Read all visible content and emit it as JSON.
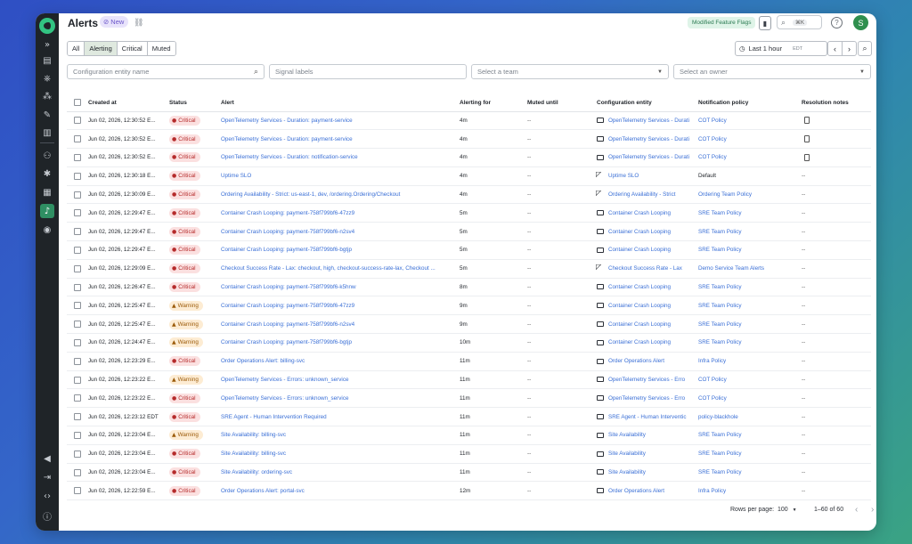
{
  "header": {
    "title": "Alerts",
    "new_badge": "New",
    "feature_flags": "Modified Feature Flags",
    "search_kbd": "⌘K",
    "avatar_initial": "S"
  },
  "tabs": [
    "All",
    "Alerting",
    "Critical",
    "Muted"
  ],
  "active_tab": "Alerting",
  "time_range": {
    "label": "Last 1 hour",
    "tz": "EDT"
  },
  "filters": {
    "entity_placeholder": "Configuration entity name",
    "signal_placeholder": "Signal labels",
    "team_placeholder": "Select a team",
    "owner_placeholder": "Select an owner"
  },
  "columns": [
    "Created at",
    "Status",
    "Alert",
    "Alerting for",
    "Muted until",
    "Configuration entity",
    "Notification policy",
    "Resolution notes"
  ],
  "rows": [
    {
      "created": "Jun 02, 2026, 12:30:52 E...",
      "status": "Critical",
      "alert": "OpenTelemetry Services - Duration: payment-service",
      "for": "4m",
      "muted": "--",
      "entity": "OpenTelemetry Services - Durati",
      "etype": "box",
      "policy": "COT Policy",
      "plink": true,
      "note": true
    },
    {
      "created": "Jun 02, 2026, 12:30:52 E...",
      "status": "Critical",
      "alert": "OpenTelemetry Services - Duration: payment-service",
      "for": "4m",
      "muted": "--",
      "entity": "OpenTelemetry Services - Durati",
      "etype": "box",
      "policy": "COT Policy",
      "plink": true,
      "note": true
    },
    {
      "created": "Jun 02, 2026, 12:30:52 E...",
      "status": "Critical",
      "alert": "OpenTelemetry Services - Duration: notification-service",
      "for": "4m",
      "muted": "--",
      "entity": "OpenTelemetry Services - Durati",
      "etype": "box",
      "policy": "COT Policy",
      "plink": true,
      "note": true
    },
    {
      "created": "Jun 02, 2026, 12:30:18 E...",
      "status": "Critical",
      "alert": "Uptime SLO",
      "for": "4m",
      "muted": "--",
      "entity": "Uptime SLO",
      "etype": "tri",
      "policy": "Default",
      "plink": false,
      "note": false
    },
    {
      "created": "Jun 02, 2026, 12:30:09 E...",
      "status": "Critical",
      "alert": "Ordering Availability - Strict: us-east-1, dev, /ordering.Ordering/Checkout",
      "for": "4m",
      "muted": "--",
      "entity": "Ordering Availability - Strict",
      "etype": "tri",
      "policy": "Ordering Team Policy",
      "plink": true,
      "note": false
    },
    {
      "created": "Jun 02, 2026, 12:29:47 E...",
      "status": "Critical",
      "alert": "Container Crash Looping: payment-758f799bf6-47zz9",
      "for": "5m",
      "muted": "--",
      "entity": "Container Crash Looping",
      "etype": "box",
      "policy": "SRE Team Policy",
      "plink": true,
      "note": false
    },
    {
      "created": "Jun 02, 2026, 12:29:47 E...",
      "status": "Critical",
      "alert": "Container Crash Looping: payment-758f799bf6-n2sv4",
      "for": "5m",
      "muted": "--",
      "entity": "Container Crash Looping",
      "etype": "box",
      "policy": "SRE Team Policy",
      "plink": true,
      "note": false
    },
    {
      "created": "Jun 02, 2026, 12:29:47 E...",
      "status": "Critical",
      "alert": "Container Crash Looping: payment-758f799bf6-bgtjp",
      "for": "5m",
      "muted": "--",
      "entity": "Container Crash Looping",
      "etype": "box",
      "policy": "SRE Team Policy",
      "plink": true,
      "note": false
    },
    {
      "created": "Jun 02, 2026, 12:29:09 E...",
      "status": "Critical",
      "alert": "Checkout Success Rate - Lax: checkout, high, checkout-success-rate-lax, Checkout ...",
      "for": "5m",
      "muted": "--",
      "entity": "Checkout Success Rate - Lax",
      "etype": "tri",
      "policy": "Demo Service Team Alerts",
      "plink": true,
      "note": false
    },
    {
      "created": "Jun 02, 2026, 12:26:47 E...",
      "status": "Critical",
      "alert": "Container Crash Looping: payment-758f799bf6-k5hnw",
      "for": "8m",
      "muted": "--",
      "entity": "Container Crash Looping",
      "etype": "box",
      "policy": "SRE Team Policy",
      "plink": true,
      "note": false
    },
    {
      "created": "Jun 02, 2026, 12:25:47 E...",
      "status": "Warning",
      "alert": "Container Crash Looping: payment-758f799bf6-47zz9",
      "for": "9m",
      "muted": "--",
      "entity": "Container Crash Looping",
      "etype": "box",
      "policy": "SRE Team Policy",
      "plink": true,
      "note": false
    },
    {
      "created": "Jun 02, 2026, 12:25:47 E...",
      "status": "Warning",
      "alert": "Container Crash Looping: payment-758f799bf6-n2sv4",
      "for": "9m",
      "muted": "--",
      "entity": "Container Crash Looping",
      "etype": "box",
      "policy": "SRE Team Policy",
      "plink": true,
      "note": false
    },
    {
      "created": "Jun 02, 2026, 12:24:47 E...",
      "status": "Warning",
      "alert": "Container Crash Looping: payment-758f799bf6-bgtjp",
      "for": "10m",
      "muted": "--",
      "entity": "Container Crash Looping",
      "etype": "box",
      "policy": "SRE Team Policy",
      "plink": true,
      "note": false
    },
    {
      "created": "Jun 02, 2026, 12:23:29 E...",
      "status": "Critical",
      "alert": "Order Operations Alert: billing-svc",
      "for": "11m",
      "muted": "--",
      "entity": "Order Operations Alert",
      "etype": "box",
      "policy": "Infra Policy",
      "plink": true,
      "note": false
    },
    {
      "created": "Jun 02, 2026, 12:23:22 E...",
      "status": "Warning",
      "alert": "OpenTelemetry Services - Errors: unknown_service",
      "for": "11m",
      "muted": "--",
      "entity": "OpenTelemetry Services - Erro",
      "etype": "box",
      "policy": "COT Policy",
      "plink": true,
      "note": false
    },
    {
      "created": "Jun 02, 2026, 12:23:22 E...",
      "status": "Critical",
      "alert": "OpenTelemetry Services - Errors: unknown_service",
      "for": "11m",
      "muted": "--",
      "entity": "OpenTelemetry Services - Erro",
      "etype": "box",
      "policy": "COT Policy",
      "plink": true,
      "note": false
    },
    {
      "created": "Jun 02, 2026, 12:23:12 EDT",
      "status": "Critical",
      "alert": "SRE Agent - Human Intervention Required",
      "for": "11m",
      "muted": "--",
      "entity": "SRE Agent - Human Interventic",
      "etype": "box",
      "policy": "policy-blackhole",
      "plink": true,
      "note": false
    },
    {
      "created": "Jun 02, 2026, 12:23:04 E...",
      "status": "Warning",
      "alert": "Site Availability: billing-svc",
      "for": "11m",
      "muted": "--",
      "entity": "Site Availability",
      "etype": "box",
      "policy": "SRE Team Policy",
      "plink": true,
      "note": false
    },
    {
      "created": "Jun 02, 2026, 12:23:04 E...",
      "status": "Critical",
      "alert": "Site Availability: billing-svc",
      "for": "11m",
      "muted": "--",
      "entity": "Site Availability",
      "etype": "box",
      "policy": "SRE Team Policy",
      "plink": true,
      "note": false
    },
    {
      "created": "Jun 02, 2026, 12:23:04 E...",
      "status": "Critical",
      "alert": "Site Availability: ordering-svc",
      "for": "11m",
      "muted": "--",
      "entity": "Site Availability",
      "etype": "box",
      "policy": "SRE Team Policy",
      "plink": true,
      "note": false
    },
    {
      "created": "Jun 02, 2026, 12:22:59 E...",
      "status": "Critical",
      "alert": "Order Operations Alert: portal-svc",
      "for": "12m",
      "muted": "--",
      "entity": "Order Operations Alert",
      "etype": "box",
      "policy": "Infra Policy",
      "plink": true,
      "note": false
    }
  ],
  "pagination": {
    "rows_per_page_label": "Rows per page:",
    "rows_per_page": "100",
    "range": "1–60 of 60"
  },
  "colors": {
    "accent": "#2f8f63",
    "critical": "#b52b2b",
    "warning": "#9b5a09",
    "link": "#3a6fd6"
  }
}
